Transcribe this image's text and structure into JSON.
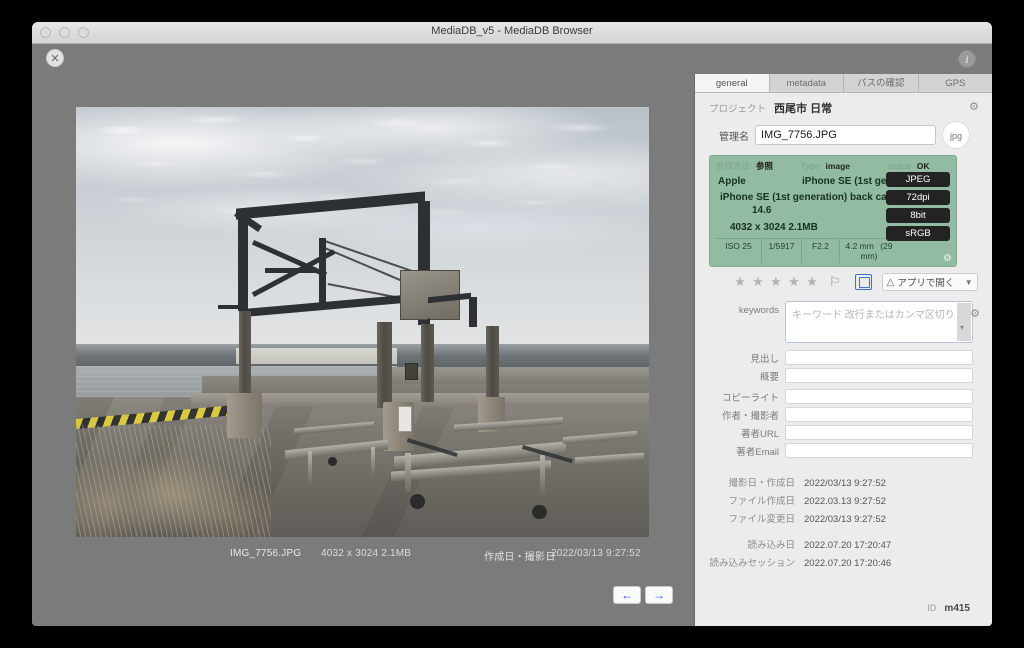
{
  "window": {
    "title": "MediaDB_v5 - MediaDB Browser",
    "close_icon": "close-icon",
    "info_icon": "info-icon"
  },
  "viewer": {
    "caption_filename": "IMG_7756.JPG",
    "caption_dimensions": "4032 x 3024  2.1MB",
    "caption_date_label": "作成日・撮影日",
    "caption_date_value": "2022/03/13 9:27:52",
    "prev_arrow": "←",
    "next_arrow": "→"
  },
  "panel": {
    "tabs": [
      {
        "label": "general",
        "active": true
      },
      {
        "label": "metadata",
        "active": false
      },
      {
        "label": "パスの確認",
        "active": false
      },
      {
        "label": "GPS",
        "active": false
      }
    ],
    "project_label": "プロジェクト",
    "project_value": "西尾市 日常",
    "name_label": "管理名",
    "name_value": "IMG_7756.JPG",
    "ext_badge": "jpg",
    "exif": {
      "method_label": "登録方法",
      "method_value": "参照",
      "type_label": "Type",
      "type_value": "image",
      "status_label": "status",
      "status_value": "OK",
      "make": "Apple",
      "model": "iPhone SE (1st generation)",
      "lens": "iPhone SE (1st generation) back camera",
      "firmware": "14.6",
      "dimensions": "4032 x 3024   2.1MB",
      "badges": [
        "JPEG",
        "72dpi",
        "8bit",
        "sRGB"
      ],
      "iso": "ISO 25",
      "shutter": "1/5917",
      "aperture": "F2.2",
      "focal": "4.2 mm",
      "focal_equiv": "(29 mm)"
    },
    "rating": {
      "stars": 5,
      "filled": 0,
      "flag_icon": "flag-icon"
    },
    "open_with_label": "アプリで開く",
    "keywords_label": "keywords",
    "keywords_placeholder": "キーワード 改行またはカンマ区切り",
    "keywords_value": "",
    "fields": [
      {
        "label": "見出し",
        "value": ""
      },
      {
        "label": "概要",
        "value": ""
      },
      {
        "label": "コピーライト",
        "value": ""
      },
      {
        "label": "作者・撮影者",
        "value": ""
      },
      {
        "label": "著者URL",
        "value": ""
      },
      {
        "label": "著者Email",
        "value": ""
      }
    ],
    "dates": [
      {
        "label": "撮影日・作成日",
        "value": "2022/03/13 9:27:52"
      },
      {
        "label": "ファイル作成日",
        "value": "2022.03.13 9:27:52"
      },
      {
        "label": "ファイル変更日",
        "value": "2022/03/13 9:27:52"
      }
    ],
    "dates2": [
      {
        "label": "読み込み日",
        "value": "2022.07.20 17:20:47"
      },
      {
        "label": "読み込みセッション",
        "value": "2022.07.20 17:20:46"
      }
    ],
    "id_label": "ID",
    "id_value": "m415"
  },
  "colors": {
    "exif_green": "#93bba4",
    "badge_dark": "#232323",
    "accent_blue": "#2a58d8",
    "panel_bg": "#ececec",
    "window_chrome": "#7b7b7b"
  }
}
